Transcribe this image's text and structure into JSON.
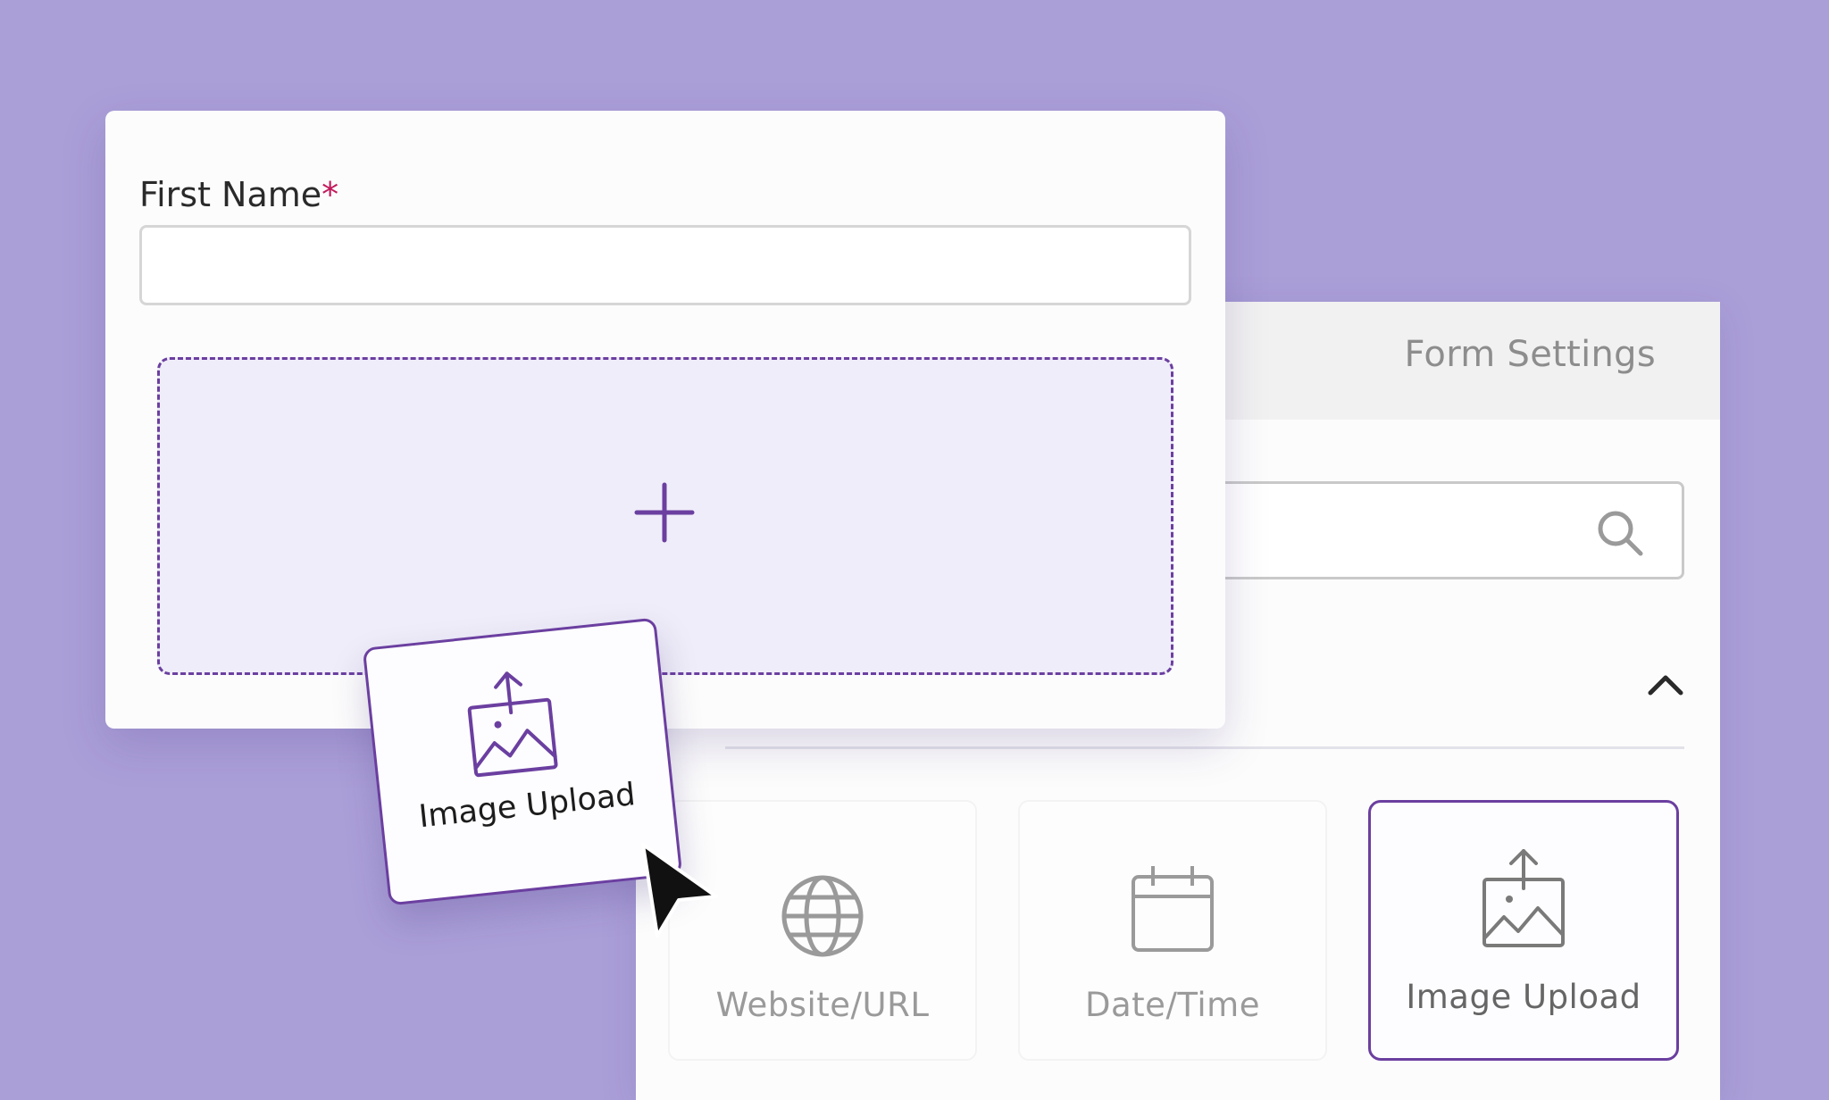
{
  "form": {
    "field_label": "First Name",
    "required_marker": "*",
    "first_name_value": "",
    "dropzone_icon": "plus-icon"
  },
  "dragged_item": {
    "label": "Image Upload",
    "icon": "image-upload-icon"
  },
  "builder": {
    "tab_label": "Form Settings",
    "search": {
      "value": "",
      "icon": "search-icon"
    },
    "section_toggle_icon": "chevron-up-icon",
    "fields": [
      {
        "label": "Website/URL",
        "icon": "globe-icon",
        "selected": false
      },
      {
        "label": "Date/Time",
        "icon": "calendar-icon",
        "selected": false
      },
      {
        "label": "Image Upload",
        "icon": "image-upload-icon",
        "selected": true
      }
    ]
  },
  "colors": {
    "background": "#ab9fd8",
    "accent": "#6b3fa0",
    "required": "#c2185b",
    "dropzone_fill": "#efedf9"
  }
}
